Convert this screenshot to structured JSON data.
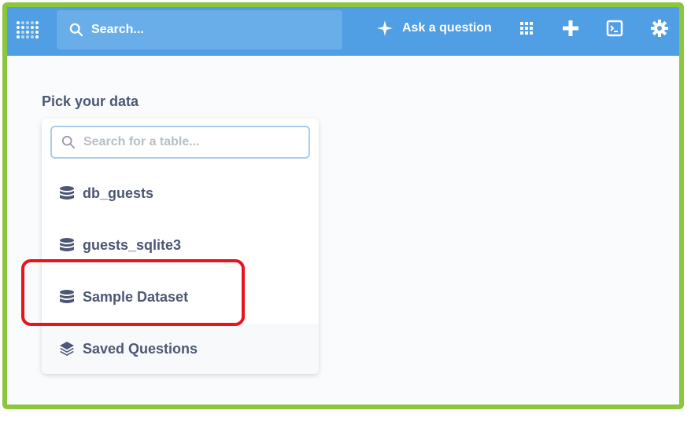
{
  "navbar": {
    "search_placeholder": "Search...",
    "ask_label": "Ask a question",
    "icons": [
      "metabase-logo-icon",
      "search-icon",
      "sparkle-icon",
      "grid-icon",
      "plus-icon",
      "terminal-icon",
      "gear-icon"
    ]
  },
  "main": {
    "title": "Pick your data",
    "picker": {
      "search_placeholder": "Search for a table...",
      "items": [
        {
          "label": "db_guests",
          "icon": "database-icon"
        },
        {
          "label": "guests_sqlite3",
          "icon": "database-icon"
        },
        {
          "label": "Sample Dataset",
          "icon": "database-icon"
        },
        {
          "label": "Saved Questions",
          "icon": "layers-icon"
        }
      ]
    }
  },
  "colors": {
    "navbar": "#509ee3",
    "text": "#4c5773",
    "highlight": "#e8141b",
    "frame": "#8cc63f"
  }
}
